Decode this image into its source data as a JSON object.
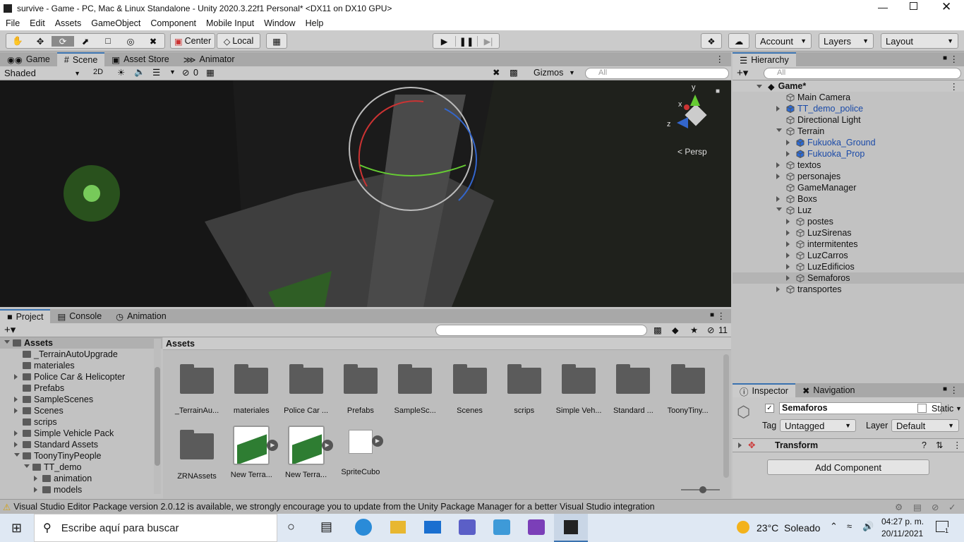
{
  "window": {
    "title": "survive - Game - PC, Mac & Linux Standalone - Unity 2020.3.22f1 Personal* <DX11 on DX10 GPU>"
  },
  "menu": [
    "File",
    "Edit",
    "Assets",
    "GameObject",
    "Component",
    "Mobile Input",
    "Window",
    "Help"
  ],
  "toolbar": {
    "pivot": "Center",
    "space": "Local",
    "account": "Account",
    "layers": "Layers",
    "layout": "Layout"
  },
  "scene_tabs": [
    "Game",
    "Scene",
    "Asset Store",
    "Animator"
  ],
  "scene_bar": {
    "shading": "Shaded",
    "mode2d": "2D",
    "hidden_count": "0",
    "gizmos": "Gizmos",
    "search_placeholder": "All",
    "persp": "Persp",
    "axis_y": "y",
    "axis_x": "x",
    "axis_z": "z"
  },
  "hierarchy": {
    "tab": "Hierarchy",
    "search_placeholder": "All",
    "scene": "Game*",
    "items": [
      {
        "label": "Main Camera",
        "prefab": false
      },
      {
        "label": "TT_demo_police",
        "prefab": true
      },
      {
        "label": "Directional Light",
        "prefab": false
      },
      {
        "label": "Terrain",
        "prefab": false
      },
      {
        "label": "Fukuoka_Ground",
        "prefab": true
      },
      {
        "label": "Fukuoka_Prop",
        "prefab": true
      },
      {
        "label": "textos",
        "prefab": false
      },
      {
        "label": "personajes",
        "prefab": false
      },
      {
        "label": "GameManager",
        "prefab": false
      },
      {
        "label": "Boxs",
        "prefab": false
      },
      {
        "label": "Luz",
        "prefab": false
      },
      {
        "label": "postes",
        "prefab": false
      },
      {
        "label": "LuzSirenas",
        "prefab": false
      },
      {
        "label": "intermitentes",
        "prefab": false
      },
      {
        "label": "LuzCarros",
        "prefab": false
      },
      {
        "label": "LuzEdificios",
        "prefab": false
      },
      {
        "label": "Semaforos",
        "prefab": false
      },
      {
        "label": "transportes",
        "prefab": false
      }
    ]
  },
  "project_tabs": [
    "Project",
    "Console",
    "Animation"
  ],
  "project": {
    "hidden_count": "11",
    "breadcrumb": "Assets",
    "tree": [
      "Assets",
      "_TerrainAutoUpgrade",
      "materiales",
      "Police Car & Helicopter",
      "Prefabs",
      "SampleScenes",
      "Scenes",
      "scrips",
      "Simple Vehicle Pack",
      "Standard Assets",
      "ToonyTinyPeople",
      "TT_demo",
      "animation",
      "models"
    ],
    "assets": [
      "_TerrainAu...",
      "materiales",
      "Police Car ...",
      "Prefabs",
      "SampleSc...",
      "Scenes",
      "scrips",
      "Simple Veh...",
      "Standard ...",
      "ToonyTiny...",
      "ZRNAssets",
      "New Terra...",
      "New Terra...",
      "SpriteCubo"
    ]
  },
  "inspector": {
    "tabs": [
      "Inspector",
      "Navigation"
    ],
    "name": "Semaforos",
    "static": "Static",
    "tag_label": "Tag",
    "tag": "Untagged",
    "layer_label": "Layer",
    "layer": "Default",
    "component": "Transform",
    "add_component": "Add Component"
  },
  "status": {
    "message": "Visual Studio Editor Package version 2.0.12 is available, we strongly encourage you to update from the Unity Package Manager for a better Visual Studio integration"
  },
  "taskbar": {
    "search_placeholder": "Escribe aquí para buscar",
    "weather": "23°C  Soleado",
    "time": "04:27 p. m.",
    "date": "20/11/2021",
    "notifications": "1"
  },
  "colors": {
    "accent": "#3a72b0",
    "prefab": "#1a4aa8",
    "selection": "#b4b4b4"
  }
}
